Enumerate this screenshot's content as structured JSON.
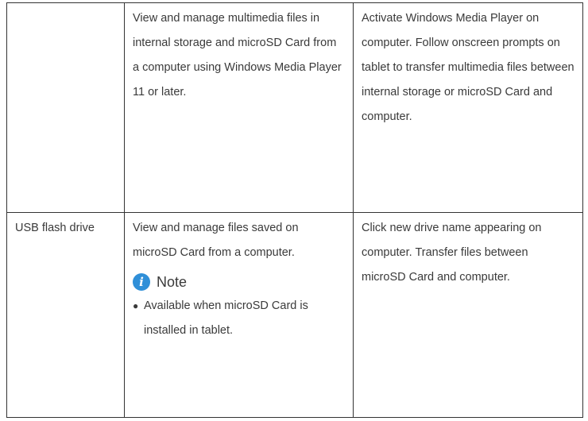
{
  "rows": [
    {
      "col1": "",
      "col2": "View and manage multimedia files in internal storage and microSD Card from a computer using Windows Media Player 11 or later.",
      "col3": "Activate Windows Media Player on computer. Follow onscreen prompts on tablet to transfer multimedia files between internal storage or microSD Card and computer."
    },
    {
      "col1": "USB flash drive",
      "col2": "View and manage files saved on microSD Card from a computer.",
      "col3": "Click new drive name appearing on computer. Transfer files between microSD Card and computer.",
      "note": {
        "icon": "info-icon",
        "label": "Note",
        "bullet": "●",
        "item": "Available when microSD Card is installed in tablet."
      }
    }
  ],
  "colors": {
    "icon": "#2f8fd8",
    "border": "#333333",
    "text": "#3a3a3a"
  }
}
